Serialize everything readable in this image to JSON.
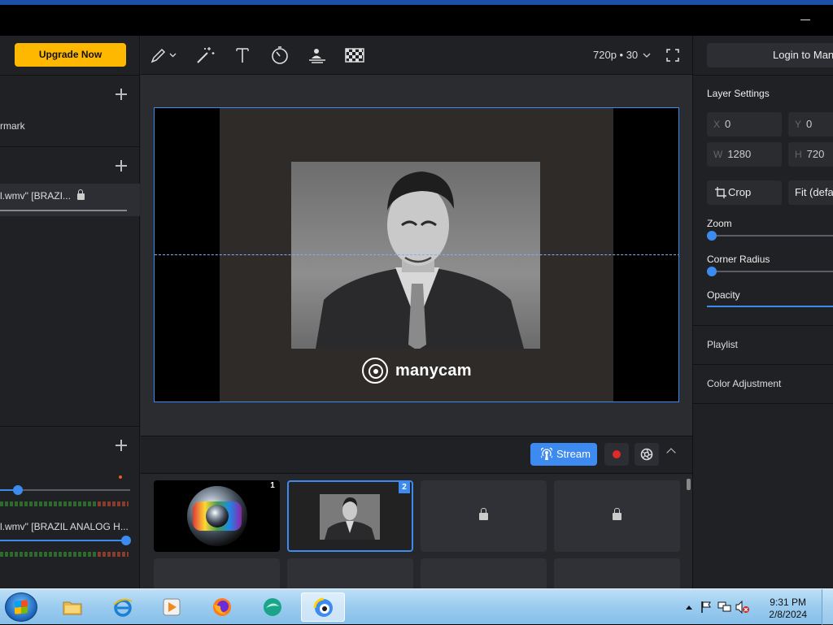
{
  "left_panel": {
    "upgrade_label": "Upgrade Now",
    "section1_item": "rmark",
    "section2_item": "l.wmv\" [BRAZI...",
    "section3_item": "l.wmv\" [BRAZIL ANALOG H..."
  },
  "toolbar": {
    "resolution": "720p • 30"
  },
  "preview": {
    "watermark": "manycam"
  },
  "stream_bar": {
    "stream_label": "Stream"
  },
  "scenes": [
    {
      "number": "1",
      "locked": false
    },
    {
      "number": "2",
      "locked": false
    },
    {
      "number": "",
      "locked": true
    },
    {
      "number": "",
      "locked": true
    }
  ],
  "right_panel": {
    "login_label": "Login to Many",
    "layer_settings": "Layer Settings",
    "x_label": "X",
    "x_value": "0",
    "y_label": "Y",
    "y_value": "0",
    "w_label": "W",
    "w_value": "1280",
    "h_label": "H",
    "h_value": "720",
    "crop_label": "Crop",
    "fit_label": "Fit (defau",
    "zoom_label": "Zoom",
    "corner_radius_label": "Corner Radius",
    "opacity_label": "Opacity",
    "playlist_label": "Playlist",
    "color_adjustment_label": "Color Adjustment"
  },
  "taskbar": {
    "time": "9:31 PM",
    "date": "2/8/2024"
  },
  "colors": {
    "accent": "#3d8bf0",
    "upgrade": "#ffb800",
    "record": "#e02a2a"
  }
}
